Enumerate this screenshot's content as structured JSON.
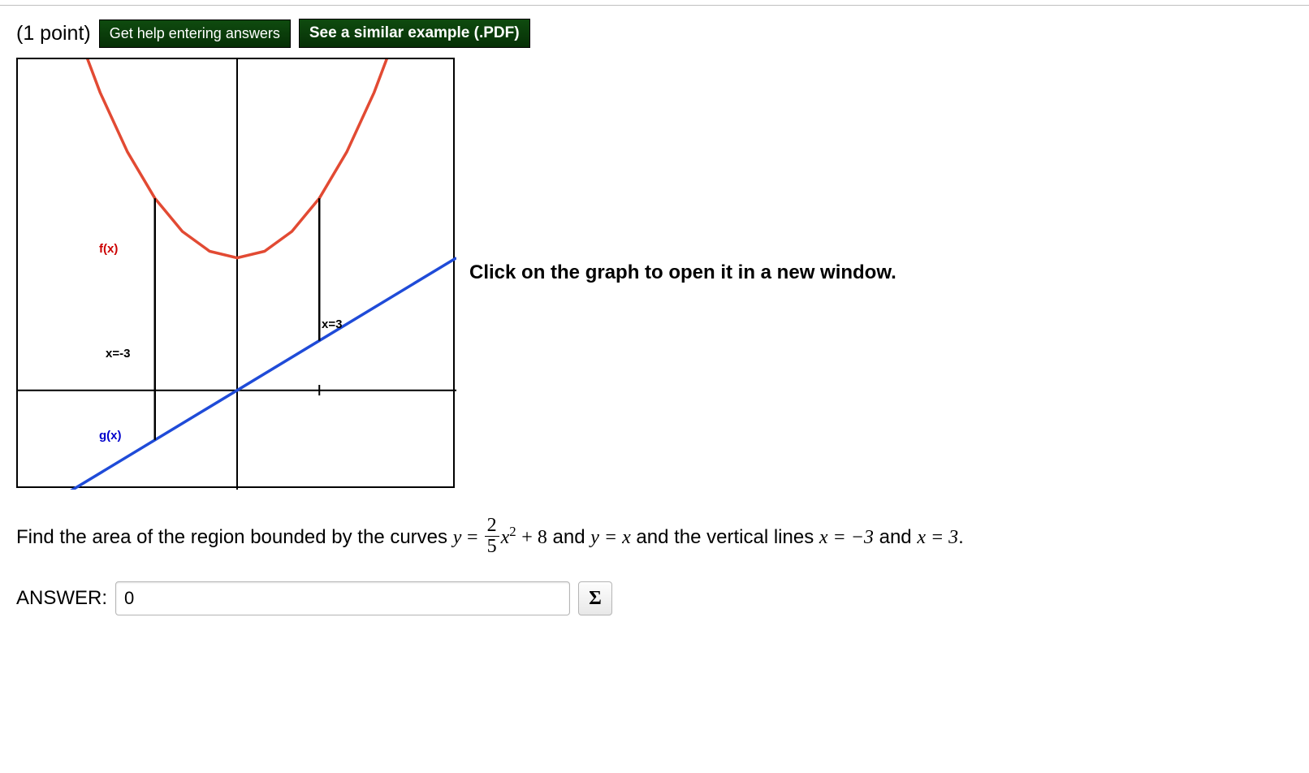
{
  "header": {
    "points": "(1 point)",
    "help_button": "Get help entering answers",
    "example_button": "See a similar example (.PDF)"
  },
  "graph": {
    "instruction": "Click on the graph to open it in a new window.",
    "labels": {
      "fx": "f(x)",
      "gx": "g(x)",
      "xneg3": "x=-3",
      "x3": "x=3"
    }
  },
  "question": {
    "prefix": "Find the area of the region bounded by the curves ",
    "eq1_lhs": "y",
    "eq": " = ",
    "frac_num": "2",
    "frac_den": "5",
    "eq1_rhs_after_frac": "x",
    "eq1_exp": "2",
    "eq1_plus": " + 8",
    "mid1": " and ",
    "eq2": "y = x",
    "mid2": " and the vertical lines ",
    "eq3": "x = −3",
    "mid3": " and ",
    "eq4": "x = 3",
    "end": "."
  },
  "answer": {
    "label": "ANSWER:",
    "value": "0",
    "sigma": "Σ"
  },
  "chart_data": {
    "type": "line",
    "title": "",
    "xlabel": "",
    "ylabel": "",
    "xlim": [
      -8,
      8
    ],
    "ylim": [
      -6,
      20
    ],
    "series": [
      {
        "name": "f(x) = (2/5)x^2 + 8",
        "color": "#d62728",
        "x": [
          -8,
          -7,
          -6,
          -5,
          -4,
          -3,
          -2,
          -1,
          0,
          1,
          2,
          3,
          4,
          5,
          6,
          7,
          8
        ],
        "y": [
          33.6,
          27.6,
          22.4,
          18.0,
          14.4,
          11.6,
          9.6,
          8.4,
          8.0,
          8.4,
          9.6,
          11.6,
          14.4,
          18.0,
          22.4,
          27.6,
          33.6
        ]
      },
      {
        "name": "g(x) = x",
        "color": "#1f4bd8",
        "x": [
          -8,
          8
        ],
        "y": [
          -8,
          8
        ]
      },
      {
        "name": "x = -3",
        "color": "#000000",
        "x": [
          -3,
          -3
        ],
        "y": [
          -3,
          11.6
        ]
      },
      {
        "name": "x = 3",
        "color": "#000000",
        "x": [
          3,
          3
        ],
        "y": [
          3,
          11.6
        ]
      }
    ],
    "annotations": [
      {
        "text": "f(x)",
        "x": -6.2,
        "y": 14,
        "color": "#cc0000"
      },
      {
        "text": "g(x)",
        "x": -6.2,
        "y": -4.5,
        "color": "#0000cc"
      },
      {
        "text": "x=-3",
        "x": -3,
        "y": -1,
        "color": "#000"
      },
      {
        "text": "x=3",
        "x": 3,
        "y": 5,
        "color": "#000"
      }
    ]
  }
}
